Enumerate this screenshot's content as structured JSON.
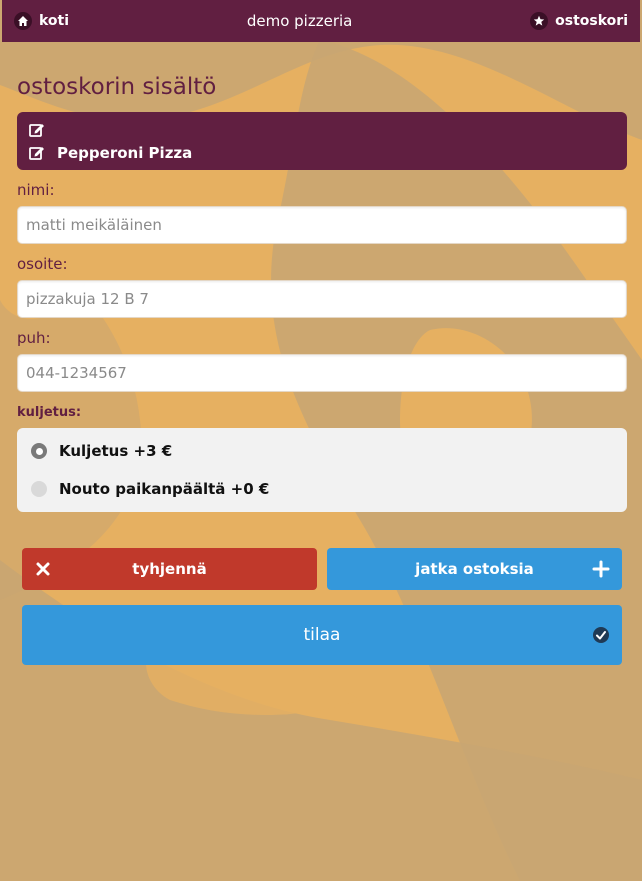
{
  "header": {
    "home_label": "koti",
    "site_title": "demo pizzeria",
    "cart_label": "ostoskori",
    "home_icon": "home-icon",
    "cart_icon": "star-icon"
  },
  "page": {
    "title": "ostoskorin sisältö"
  },
  "cart": {
    "items": [
      {
        "name": ""
      },
      {
        "name": "Pepperoni Pizza"
      }
    ]
  },
  "form": {
    "name_label": "nimi:",
    "name_placeholder": "matti meikäläinen",
    "address_label": "osoite:",
    "address_placeholder": "pizzakuja 12 B 7",
    "phone_label": "puh:",
    "phone_placeholder": "044-1234567"
  },
  "delivery": {
    "label": "kuljetus:",
    "options": [
      {
        "label": "Kuljetus +3 €",
        "selected": true
      },
      {
        "label": "Nouto paikanpäältä +0 €",
        "selected": false
      }
    ]
  },
  "buttons": {
    "clear_label": "tyhjennä",
    "continue_label": "jatka ostoksia",
    "order_label": "tilaa"
  },
  "colors": {
    "brand": "#611f41",
    "background": "#e6b061",
    "danger": "#c0392b",
    "primary": "#3498db"
  }
}
